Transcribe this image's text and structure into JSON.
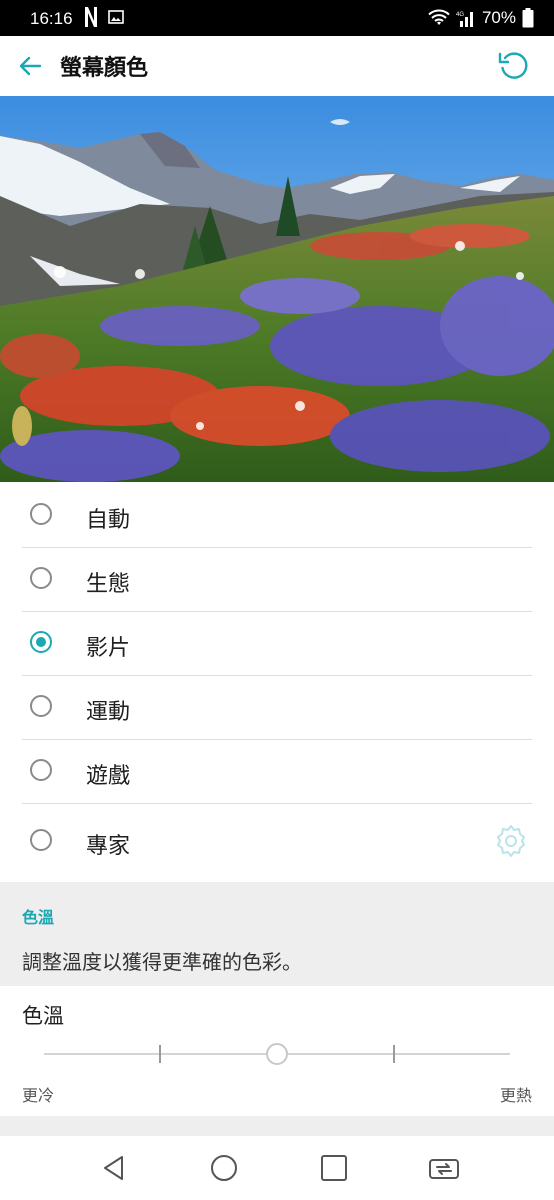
{
  "status_bar": {
    "time": "16:16",
    "battery": "70%",
    "network": "4G"
  },
  "header": {
    "title": "螢幕顏色"
  },
  "options": [
    {
      "label": "自動",
      "selected": false
    },
    {
      "label": "生態",
      "selected": false
    },
    {
      "label": "影片",
      "selected": true
    },
    {
      "label": "運動",
      "selected": false
    },
    {
      "label": "遊戲",
      "selected": false
    },
    {
      "label": "專家",
      "selected": false
    }
  ],
  "color_temp_section": {
    "title": "色溫",
    "description": "調整溫度以獲得更準確的色彩。",
    "slider_label": "色溫",
    "cooler_label": "更冷",
    "warmer_label": "更熱",
    "slider_value": 0.5
  },
  "colors": {
    "accent": "#1aa8b4",
    "section_bg": "#eeeeee"
  },
  "icons": {
    "back": "arrow-left-icon",
    "reset": "refresh-icon",
    "settings": "gear-icon"
  }
}
